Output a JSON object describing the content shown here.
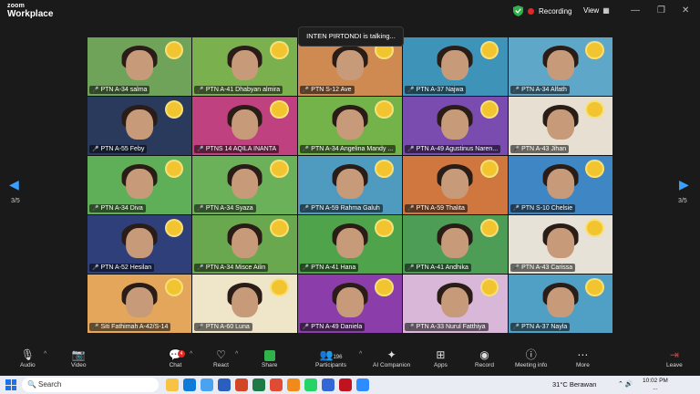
{
  "app": {
    "brand_top": "zoom",
    "brand_bottom": "Workplace"
  },
  "status": {
    "recording": "Recording",
    "view": "View"
  },
  "talking_banner": "INTEN PIRTONDI is talking...",
  "pagination": {
    "left": "3/5",
    "right": "3/5"
  },
  "participants": [
    {
      "name": "PTN A-34 salma",
      "bg": "#6fa35a"
    },
    {
      "name": "PTN A-41 Dhabyan almira",
      "bg": "#7bb04e"
    },
    {
      "name": "PTN S-12 Ave",
      "bg": "#cf8a52"
    },
    {
      "name": "PTN A-37 Najwa",
      "bg": "#3e93b8"
    },
    {
      "name": "PTN A-34 Alfath",
      "bg": "#5fa7c9"
    },
    {
      "name": "PTN A-55 Feby",
      "bg": "#2a3a5c"
    },
    {
      "name": "PTNS 14 AQILA INANTA",
      "bg": "#c0417f"
    },
    {
      "name": "PTN A-34 Angelina Mandy ...",
      "bg": "#74b24a"
    },
    {
      "name": "PTN A-49 Agustinus Naren...",
      "bg": "#7b4cb0"
    },
    {
      "name": "PTN A-43 Jihan",
      "bg": "#e7e0d2"
    },
    {
      "name": "PTN A-34 Diva",
      "bg": "#5fae58"
    },
    {
      "name": "PTN A-34 Syaza",
      "bg": "#6ab15a"
    },
    {
      "name": "PTN A-59 Rahma Galuh",
      "bg": "#4f9bc0"
    },
    {
      "name": "PTN A-59 Thalita",
      "bg": "#d0763f"
    },
    {
      "name": "PTN S-10 Chelsie",
      "bg": "#3f86c4"
    },
    {
      "name": "PTN A-52 Hesilan",
      "bg": "#2e3f7a"
    },
    {
      "name": "PTN A-34 Misce Ailin",
      "bg": "#69a84f"
    },
    {
      "name": "PTN A-41 Hana",
      "bg": "#4ea34b"
    },
    {
      "name": "PTN A-41 Andhika",
      "bg": "#4e9d57"
    },
    {
      "name": "PTN A-43 Carissa",
      "bg": "#e6e2d8"
    },
    {
      "name": "Siti Fathimah A-42/S-14",
      "bg": "#e3a65a"
    },
    {
      "name": "PTN A-60 Luna",
      "bg": "#efe6c9"
    },
    {
      "name": "PTN A-49 Daniela",
      "bg": "#8b3ea9"
    },
    {
      "name": "PTN A-33 Nurul Fatthiya",
      "bg": "#d9b7d8"
    },
    {
      "name": "PTN A-37 Nayla",
      "bg": "#4fa0c4"
    }
  ],
  "toolbar": {
    "audio": "Audio",
    "video": "Video",
    "chat": "Chat",
    "chat_badge": "4",
    "react": "React",
    "share": "Share",
    "participants": "Participants",
    "participants_count": "196",
    "ai_companion": "AI Companion",
    "apps": "Apps",
    "record": "Record",
    "meeting_info": "Meeting info",
    "more": "More",
    "leave": "Leave"
  },
  "taskbar": {
    "search": "Search",
    "weather": "31°C Berawan",
    "clock_time": "10:02 PM",
    "clock_date": "..."
  },
  "colors": {
    "accent": "#3aa0ff",
    "record": "#e02828",
    "share": "#2fb34a"
  }
}
